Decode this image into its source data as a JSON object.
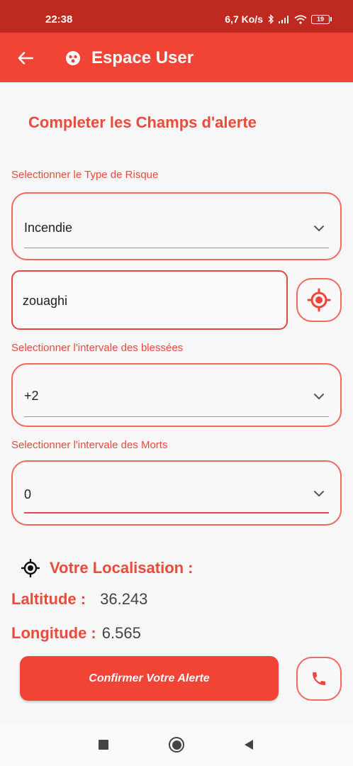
{
  "status_bar": {
    "time": "22:38",
    "network_speed": "6,7 Ko/s",
    "battery": "19",
    "icons": [
      "bluetooth-icon",
      "signal-icon",
      "wifi-icon",
      "battery-icon"
    ]
  },
  "app_bar": {
    "title": "Espace User",
    "icons": [
      "back-arrow-icon",
      "app-logo-icon"
    ]
  },
  "form": {
    "title": "Completer les Champs d'alerte",
    "risk_label": "Selectionner le Type de Risque",
    "risk_value": "Incendie",
    "location_value": "zouaghi",
    "injured_label": "Selectionner l'intervale des blessées",
    "injured_value": "+2",
    "deaths_label": "Selectionner l'intervale des Morts",
    "deaths_value": "0"
  },
  "location": {
    "title": "Votre Localisation :",
    "latitude_label": "Laltitude :",
    "latitude_value": "36.243",
    "longitude_label": "Longitude :",
    "longitude_value": "6.565"
  },
  "actions": {
    "confirm_label": "Confirmer Votre Alerte"
  },
  "colors": {
    "accent": "#f24436",
    "status_bar": "#bf2a20",
    "text_accent": "#ee4a3c",
    "border": "#ee6a63"
  }
}
